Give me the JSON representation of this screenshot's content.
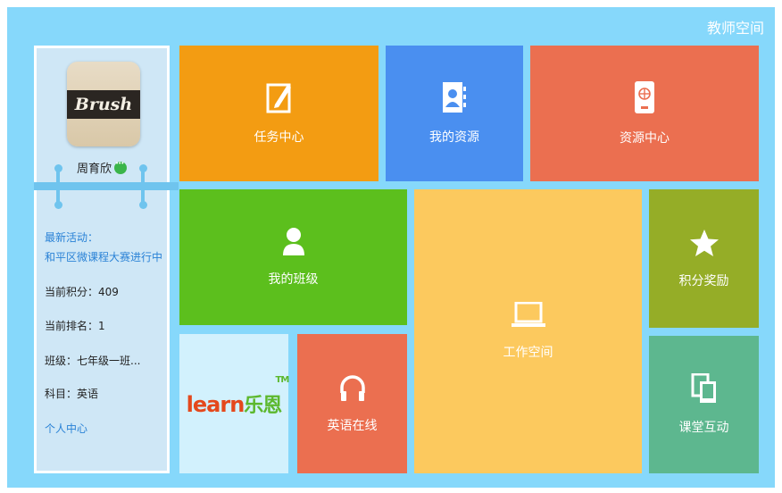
{
  "header": {
    "title": "教师空间"
  },
  "profile": {
    "avatar_text": "Brush",
    "name": "周育欣",
    "activity_label": "最新活动：",
    "activity_text": "和平区微课程大赛进行中",
    "points": "当前积分：409",
    "rank": "当前排名：1",
    "class": "班级：七年级一班...",
    "subject": "科目：英语",
    "personal_center": "个人中心"
  },
  "tiles": {
    "task_center": "任务中心",
    "my_resources": "我的资源",
    "resource_center": "资源中心",
    "my_class": "我的班级",
    "work_space": "工作空间",
    "points_rewards": "积分奖励",
    "english_online": "英语在线",
    "classroom_interaction": "课堂互动",
    "learn_logo_text": "learn",
    "learn_logo_cn": "乐恩",
    "learn_logo_tm": "TM"
  },
  "colors": {
    "background": "#86d8fb",
    "task": "#f39c12",
    "my_resources": "#4a8ff0",
    "resource_center": "#eb6f50",
    "my_class": "#5cbf1d",
    "work_space": "#fcc95e",
    "points": "#95ad27",
    "english": "#eb6f50",
    "interaction": "#5db78f"
  },
  "icons": {
    "task_center": "edit-note-icon",
    "my_resources": "contact-book-icon",
    "resource_center": "mobile-device-icon",
    "my_class": "user-icon",
    "work_space": "laptop-icon",
    "points_rewards": "star-icon",
    "english_online": "headphones-icon",
    "classroom_interaction": "copy-devices-icon",
    "name_badge": "chat-bubble-icon"
  }
}
